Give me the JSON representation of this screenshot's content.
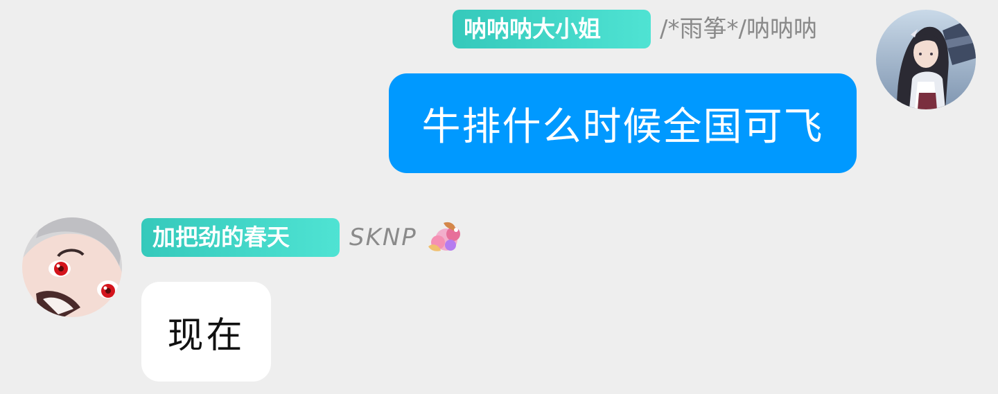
{
  "messages": [
    {
      "side": "right",
      "title_badge": "呐呐呐大小姐",
      "sender_name": "/*雨筝*/呐呐呐",
      "text": "牛排什么时候全国可飞",
      "bubble_color": "#0099ff"
    },
    {
      "side": "left",
      "title_badge": "加把劲的春天",
      "sender_name": "SKNP",
      "sticker_icon": "flower-dragon-icon",
      "text": "现在",
      "bubble_color": "#ffffff"
    }
  ],
  "colors": {
    "background": "#eeeeee",
    "badge_gradient_start": "#35c9bb",
    "badge_gradient_end": "#4fe3d3",
    "name_gray": "#8a8a8a"
  }
}
